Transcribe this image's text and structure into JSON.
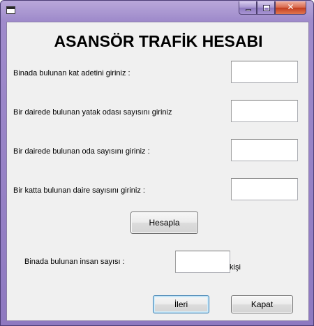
{
  "window": {
    "title": "",
    "icon": "app-window-icon",
    "controls": {
      "minimize": "minimize-icon",
      "maximize": "maximize-icon",
      "close": "✕"
    }
  },
  "form": {
    "heading": "ASANSÖR TRAFİK HESABI",
    "fields": [
      {
        "label": "Binada bulunan kat adetini giriniz :",
        "value": ""
      },
      {
        "label": "Bir dairede bulunan yatak odası sayısını giriniz",
        "value": ""
      },
      {
        "label": "Bir dairede bulunan oda sayısını giriniz :",
        "value": ""
      },
      {
        "label": "Bir katta bulunan daire sayısını giriniz :",
        "value": ""
      }
    ],
    "calculate_label": "Hesapla",
    "result": {
      "label": "Binada bulunan insan sayısı :",
      "value": "",
      "unit": "kişi"
    },
    "next_label": "İleri",
    "close_label": "Kapat"
  }
}
